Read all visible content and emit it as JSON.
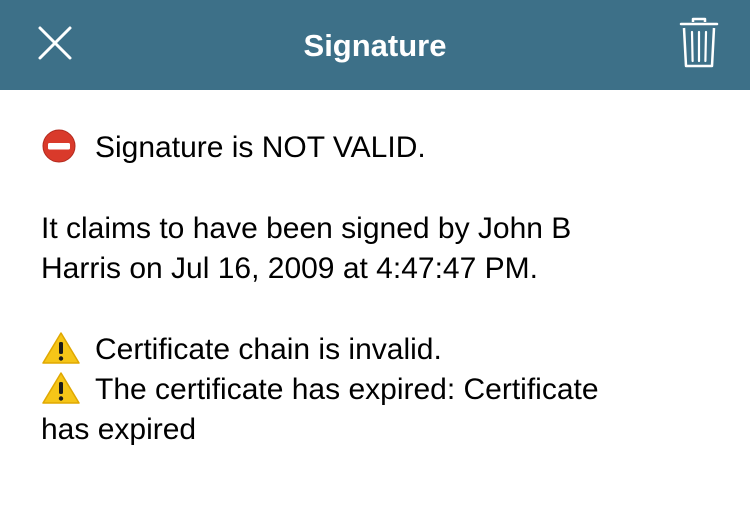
{
  "header": {
    "title": "Signature",
    "close_icon": "close-icon",
    "trash_icon": "trash-icon",
    "background_color": "#3d7088"
  },
  "status": {
    "icon": "no-entry-icon",
    "text": "Signature is NOT VALID."
  },
  "signer": {
    "line1": "It claims to have been signed by John B",
    "line2": "Harris on Jul 16, 2009 at 4:47:47 PM."
  },
  "warnings": [
    {
      "icon": "warning-icon",
      "line1": "Certificate chain is invalid."
    },
    {
      "icon": "warning-icon",
      "line1": "The certificate has expired: Certificate",
      "line2": "has expired"
    }
  ]
}
